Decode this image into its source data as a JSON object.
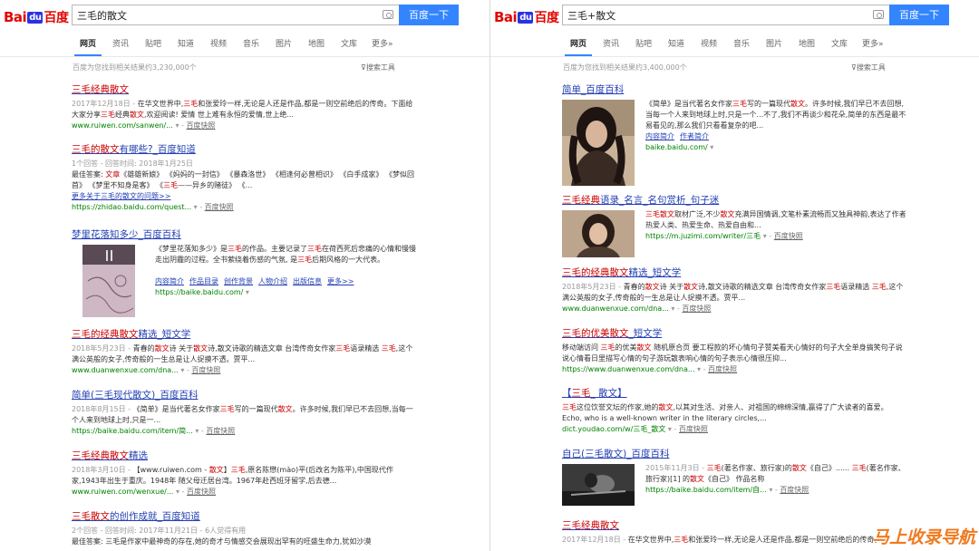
{
  "left": {
    "logo": {
      "bai": "Bai",
      "du": "du",
      "baidu": "百度"
    },
    "query": "三毛的散文",
    "search_button": "百度一下",
    "tabs": [
      "网页",
      "资讯",
      "贴吧",
      "知道",
      "视频",
      "音乐",
      "图片",
      "地图",
      "文库",
      "更多»"
    ],
    "result_count": "百度为您找到相关结果约3,230,000个",
    "search_tools": "搜索工具",
    "results": [
      {
        "title_parts": [
          {
            "t": "三毛经典散文",
            "h": true
          }
        ],
        "body": [
          {
            "t": "2017年12月18日 - ",
            "d": true
          },
          {
            "t": "在华文世界中,"
          },
          {
            "t": "三毛",
            "h": true
          },
          {
            "t": "和张爱玲一样,无论是人还是作品,都是一则空前绝后的传奇。下面给大家分享"
          },
          {
            "t": "三毛",
            "h": true
          },
          {
            "t": "经典"
          },
          {
            "t": "散文",
            "h": true
          },
          {
            "t": ",欢迎阅读! 爱情 世上难有永恒的爱情,世上绝..."
          }
        ],
        "url": "www.ruiwen.com/sanwen/...",
        "snap": "百度快照"
      },
      {
        "title_parts": [
          {
            "t": "三毛的散文",
            "h": true
          },
          {
            "t": "有哪些?_百度知道"
          }
        ],
        "body": [
          {
            "t": "1个回答 - 回答时间: 2018年1月25日",
            "d": true
          },
          {
            "t": "\n最佳答案: "
          },
          {
            "t": "文章",
            "h": true
          },
          {
            "t": "《雄雄新娘》 《妈妈的一封信》 《暴森洛世》 《相逢何必曾相识》 《白手成家》 《梦似回首》 《梦里不知身是客》 《"
          },
          {
            "t": "三毛",
            "h": true
          },
          {
            "t": "——异乡的赌徒》 《..."
          }
        ],
        "more": "更多关于三毛的散文的问题>>",
        "url": "https://zhidao.baidu.com/quest...",
        "snap": "百度快照"
      },
      {
        "title_parts": [
          {
            "t": "梦里花落知多少_百度百科"
          }
        ],
        "body": [
          {
            "t": "《梦里花落知多少》是"
          },
          {
            "t": "三毛",
            "h": true
          },
          {
            "t": "的作品。主要记录了"
          },
          {
            "t": "三毛",
            "h": true
          },
          {
            "t": "在荷西死后悲痛的心情和慢慢走出阴霾的过程。全书萦绕着伤感的气氛, 是"
          },
          {
            "t": "三毛",
            "h": true
          },
          {
            "t": "后期风格的一大代表。"
          }
        ],
        "sublinks": [
          "内容简介",
          "作品目录",
          "创作背景",
          "人物介绍",
          "出版信息",
          "更多>>"
        ],
        "url": "https://baike.baidu.com/",
        "snap": ""
      },
      {
        "title_parts": [
          {
            "t": "三毛的经典散文",
            "h": true
          },
          {
            "t": "精选_短文学"
          }
        ],
        "body": [
          {
            "t": "2018年5月23日 - ",
            "d": true
          },
          {
            "t": "青春的"
          },
          {
            "t": "散文",
            "h": true
          },
          {
            "t": "诗 关于"
          },
          {
            "t": "散文",
            "h": true
          },
          {
            "t": "诗,散文诗歌的精选文章 台湾传奇女作家"
          },
          {
            "t": "三毛",
            "h": true
          },
          {
            "t": "语录精选 "
          },
          {
            "t": "三毛",
            "h": true
          },
          {
            "t": ",这个满公英般的女子,传奇般的一生总是让人捉摸不透。贾平..."
          }
        ],
        "url": "www.duanwenxue.com/dna...",
        "snap": "百度快照"
      },
      {
        "title_parts": [
          {
            "t": "简单(三毛现代散文)_百度百科"
          }
        ],
        "body": [
          {
            "t": "2018年8月15日 - ",
            "d": true
          },
          {
            "t": "《简单》是当代著名女作家"
          },
          {
            "t": "三毛",
            "h": true
          },
          {
            "t": "写的一篇现代"
          },
          {
            "t": "散文",
            "h": true
          },
          {
            "t": "。许多时候,我们早已不去回想,当每一个人来到地球上时,只是一..."
          }
        ],
        "url": "https://baike.baidu.com/item/简...",
        "snap": "百度快照"
      },
      {
        "title_parts": [
          {
            "t": "三毛经典散文",
            "h": true
          },
          {
            "t": "精选"
          }
        ],
        "body": [
          {
            "t": "2018年3月10日 - ",
            "d": true
          },
          {
            "t": "【www.ruiwen.com - "
          },
          {
            "t": "散文",
            "h": true
          },
          {
            "t": "】"
          },
          {
            "t": "三毛",
            "h": true
          },
          {
            "t": ",原名陈懋(mào)平(后改名为陈平),中国现代作家,1943年出生于重庆。1948年 随父母迁居台湾。1967年赴西班牙留学,后去德..."
          }
        ],
        "url": "www.ruiwen.com/wenxue/...",
        "snap": "百度快照"
      },
      {
        "title_parts": [
          {
            "t": "三毛散文",
            "h": true
          },
          {
            "t": "的创作成就_百度知道"
          }
        ],
        "body": [
          {
            "t": "2个回答 - 回答时间: 2017年11月21日 - 6人觉得有用",
            "d": true
          },
          {
            "t": "\n最佳答案: 三毛是作家中最神奇的存在,她的奇才与情感交会展现出罕有的旺盛生命力,犹如沙漠"
          }
        ],
        "url": "",
        "snap": ""
      }
    ]
  },
  "right": {
    "logo": {
      "bai": "Bai",
      "du": "du",
      "baidu": "百度"
    },
    "query": "三毛+散文",
    "search_button": "百度一下",
    "tabs": [
      "网页",
      "资讯",
      "贴吧",
      "知道",
      "视频",
      "音乐",
      "图片",
      "地图",
      "文库",
      "更多»"
    ],
    "result_count": "百度为您找到相关结果约3,400,000个",
    "search_tools": "搜索工具",
    "results": [
      {
        "title_parts": [
          {
            "t": "简单_百度百科"
          }
        ],
        "body": [
          {
            "t": "《简单》是当代著名女作家"
          },
          {
            "t": "三毛",
            "h": true
          },
          {
            "t": "写的一篇现代"
          },
          {
            "t": "散文",
            "h": true
          },
          {
            "t": "。许多时候,我们早已不去回想,当每一个人来到地球上时,只是一个...不了,我们不再谈少和花朵,简单的东西是最不易看见的,那么我们只看看复杂的吧..."
          }
        ],
        "sublinks": [
          "内容简介",
          "作者简介"
        ],
        "url": "baike.baidu.com/",
        "snap": ""
      },
      {
        "title_parts": [
          {
            "t": "三毛经典",
            "h": true
          },
          {
            "t": "语录_名言_名句赏析_句子迷"
          }
        ],
        "body": [
          {
            "t": "三毛散文",
            "h": true
          },
          {
            "t": "取材广泛,不少"
          },
          {
            "t": "散文",
            "h": true
          },
          {
            "t": "充满异国情调,文笔朴素流畅而又独具神韵,表达了作者热爱人类、热爱生命、热爱自由和..."
          }
        ],
        "url": "https://m.juzimi.com/writer/三毛",
        "snap": "百度快照"
      },
      {
        "title_parts": [
          {
            "t": "三毛的经典散文",
            "h": true
          },
          {
            "t": "精选_短文学"
          }
        ],
        "body": [
          {
            "t": "2018年5月23日 - ",
            "d": true
          },
          {
            "t": "青春的"
          },
          {
            "t": "散文",
            "h": true
          },
          {
            "t": "诗 关于"
          },
          {
            "t": "散文",
            "h": true
          },
          {
            "t": "诗,散文诗歌的精选文章 台湾传奇女作家"
          },
          {
            "t": "三毛",
            "h": true
          },
          {
            "t": "语录精选 "
          },
          {
            "t": "三毛",
            "h": true
          },
          {
            "t": ",这个满公英般的女子,传奇般的一生总是让人捉摸不透。贾平..."
          }
        ],
        "url": "www.duanwenxue.com/dna...",
        "snap": "百度快照"
      },
      {
        "title_parts": [
          {
            "t": "三毛的优美散文",
            "h": true
          },
          {
            "t": "_短文学"
          }
        ],
        "body": [
          {
            "t": "移动端访问 "
          },
          {
            "t": "三毛",
            "h": true
          },
          {
            "t": "的优美"
          },
          {
            "t": "散文",
            "h": true
          },
          {
            "t": " 随机原合页 要工程款的坏心情句子赞美看天心情好的句子大全单身搞笑句子说说心情看日里描写心情的句子游玩散表响心情的句子表示心情很压抑..."
          }
        ],
        "url": "https://www.duanwenxue.com/dna...",
        "snap": "百度快照"
      },
      {
        "title_parts": [
          {
            "t": "【"
          },
          {
            "t": "三毛",
            "h": true
          },
          {
            "t": "_ 散文】"
          }
        ],
        "body": [
          {
            "t": "三毛",
            "h": true
          },
          {
            "t": "这位饮誉文坛的作家,她的"
          },
          {
            "t": "散文",
            "h": true
          },
          {
            "t": ",以其对生活、对亲人、对祖国的绵绵深情,赢得了广大读者的喜爱。 Echo, who is a well-known writer in the literary circles,..."
          }
        ],
        "url": "dict.youdao.com/w/三毛_散文",
        "snap": "百度快照"
      },
      {
        "title_parts": [
          {
            "t": "自己(三毛散文)_百度百科"
          }
        ],
        "body": [
          {
            "t": "2015年11月3日 - ",
            "d": true
          },
          {
            "t": "三毛",
            "h": true
          },
          {
            "t": "(著名作家、旅行家)的"
          },
          {
            "t": "散文",
            "h": true
          },
          {
            "t": "《自己》...... "
          },
          {
            "t": "三毛",
            "h": true
          },
          {
            "t": "(著名作家、旅行家)[1] 的"
          },
          {
            "t": "散文",
            "h": true
          },
          {
            "t": "《自己》 作品名称"
          }
        ],
        "url": "https://baike.baidu.com/item/自...",
        "snap": "百度快照"
      },
      {
        "title_parts": [
          {
            "t": "三毛经典散文",
            "h": true
          }
        ],
        "body": [
          {
            "t": "2017年12月18日 - ",
            "d": true
          },
          {
            "t": "在华文世界中,"
          },
          {
            "t": "三毛",
            "h": true
          },
          {
            "t": "和张爱玲一样,无论是人还是作品,都是一则空前绝后的传奇。"
          }
        ],
        "url": "",
        "snap": ""
      }
    ]
  },
  "watermark": "马上收录导航",
  "colors": {
    "link": "#2440b3",
    "highlight": "#cc0000",
    "button": "#3385ff",
    "url_green": "#008000",
    "logo_red": "#e10601",
    "logo_blue": "#2932e1"
  }
}
